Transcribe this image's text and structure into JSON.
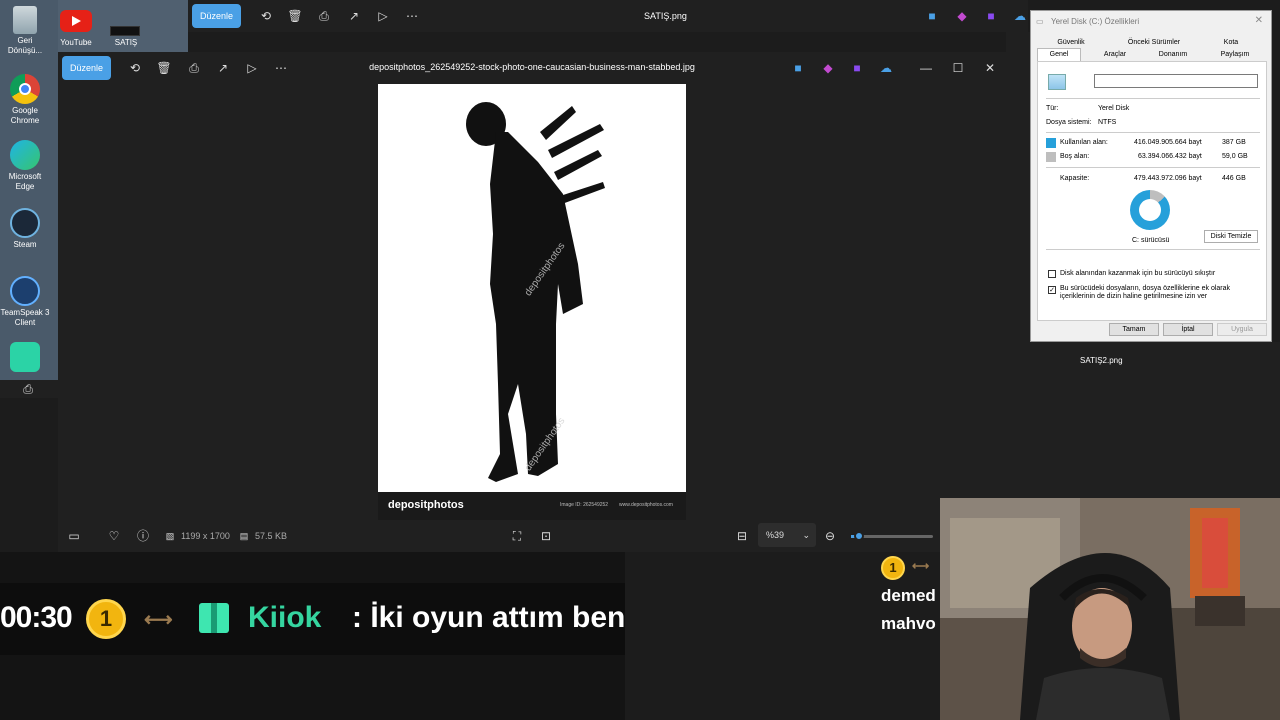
{
  "desktop": {
    "icons": [
      {
        "label": "Geri Dönüşü...",
        "icon": "recycle-bin-icon"
      },
      {
        "label": "Google Chrome",
        "icon": "chrome-icon"
      },
      {
        "label": "Microsoft Edge",
        "icon": "edge-icon"
      },
      {
        "label": "Steam",
        "icon": "steam-icon"
      },
      {
        "label": "TeamSpeak 3 Client",
        "icon": "teamspeak-icon"
      }
    ],
    "top_icons": [
      {
        "label": "YouTube",
        "icon": "youtube-icon"
      },
      {
        "label": "SATIŞ",
        "icon": "file-icon"
      }
    ]
  },
  "bg_viewer": {
    "edit_label": "Düzenle",
    "title": "SATIŞ.png"
  },
  "viewer": {
    "edit_label": "Düzenle",
    "title": "depositphotos_262549252-stock-photo-one-caucasian-business-man-stabbed.jpg",
    "dimensions": "1199 x 1700",
    "file_size": "57.5 KB",
    "zoom": "%39",
    "zoom_fraction": 0.1,
    "photo_footer": {
      "logo": "depositphotos",
      "image_id": "Image ID: 262549252",
      "site": "www.depositphotos.com"
    },
    "watermark": "depositphotos"
  },
  "properties": {
    "title": "Yerel Disk (C:) Özellikleri",
    "tabs_row1": [
      "Güvenlik",
      "Önceki Sürümler",
      "Kota"
    ],
    "tabs_row2": [
      "Genel",
      "Araçlar",
      "Donanım",
      "Paylaşım"
    ],
    "type_label": "Tür:",
    "type_value": "Yerel Disk",
    "fs_label": "Dosya sistemi:",
    "fs_value": "NTFS",
    "used_label": "Kullanılan alan:",
    "used_bytes": "416.049.905.664 bayt",
    "used_gb": "387 GB",
    "free_label": "Boş alan:",
    "free_bytes": "63.394.066.432 bayt",
    "free_gb": "59,0 GB",
    "cap_label": "Kapasite:",
    "cap_bytes": "479.443.972.096 bayt",
    "cap_gb": "446 GB",
    "drive_label": "C: sürücüsü",
    "cleanup_label": "Diski Temizle",
    "compress_label": "Disk alanından kazanmak için bu sürücüyü sıkıştır",
    "index_label": "Bu sürücüdeki dosyaların, dosya özelliklerine ek olarak içeriklerinin de dizin haline getirilmesine izin ver",
    "ok_label": "Tamam",
    "cancel_label": "İptal",
    "apply_label": "Uygula",
    "used_color": "#26a0da",
    "free_color": "#bebebe"
  },
  "chat": {
    "time": "00:30",
    "badge": "1",
    "user": "Kiiok",
    "message": ": İki oyun attım ben"
  },
  "chat2": {
    "badge": "1",
    "line1": "demed",
    "line2": "mahvo"
  },
  "bg_file2": "SATIŞ2.png"
}
